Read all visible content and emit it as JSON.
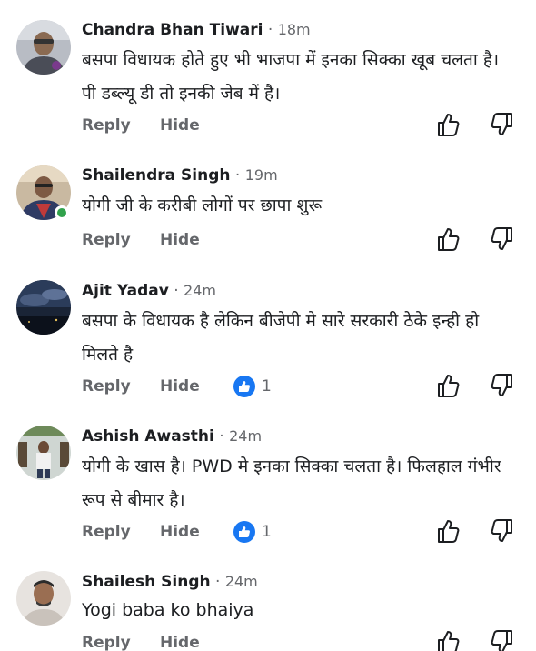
{
  "actions": {
    "reply_label": "Reply",
    "hide_label": "Hide"
  },
  "separator": "·",
  "comments": [
    {
      "author": "Chandra Bhan Tiwari",
      "time": "18m",
      "text": "बसपा विधायक होते हुए भी भाजपा में इनका सिक्का खूब चलता है। पी डब्ल्यू डी तो इनकी जेब में है।",
      "reaction_count": null
    },
    {
      "author": "Shailendra Singh",
      "time": "19m",
      "text": "योगी जी के करीबी लोगों पर छापा शुरू",
      "reaction_count": null,
      "online": true
    },
    {
      "author": "Ajit Yadav",
      "time": "24m",
      "text": "बसपा के विधायक है लेकिन बीजेपी मे सारे सरकारी ठेके इन्ही हो मिलते है",
      "reaction_count": "1"
    },
    {
      "author": "Ashish Awasthi",
      "time": "24m",
      "text": "योगी के खास है। PWD मे इनका सिक्का चलता है। फिलहाल गंभीर रूप से बीमार है।",
      "reaction_count": "1"
    },
    {
      "author": "Shailesh Singh",
      "time": "24m",
      "text": "Yogi baba ko bhaiya",
      "reaction_count": null
    }
  ],
  "colors": {
    "secondary_text": "#65676b",
    "like_blue": "#1877f2",
    "online_green": "#31a24c"
  },
  "icons": {
    "thumbs_up": "thumbs-up-icon",
    "thumbs_down": "thumbs-down-icon",
    "like": "like-reaction-icon"
  }
}
